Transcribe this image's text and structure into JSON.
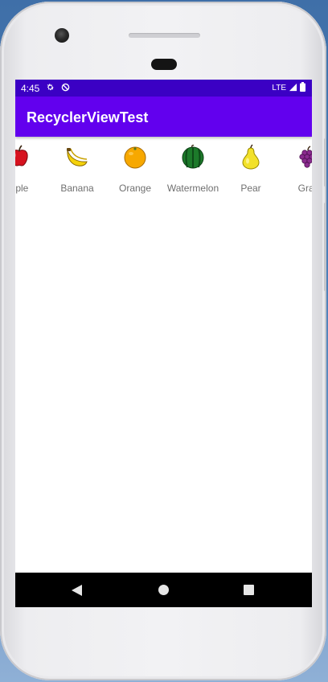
{
  "status_bar": {
    "time": "4:45",
    "icons": [
      "settings-icon",
      "no-disturb-icon"
    ],
    "network": "LTE",
    "right_icons": [
      "signal-icon",
      "battery-icon"
    ],
    "color": "#3b00c4"
  },
  "app_bar": {
    "title": "RecyclerViewTest",
    "color": "#6200ee"
  },
  "fruit_list": {
    "orientation": "horizontal",
    "items": [
      {
        "name": "Apple",
        "visible_text": "pple",
        "icon": "apple-icon"
      },
      {
        "name": "Banana",
        "visible_text": "Banana",
        "icon": "banana-icon"
      },
      {
        "name": "Orange",
        "visible_text": "Orange",
        "icon": "orange-icon"
      },
      {
        "name": "Watermelon",
        "visible_text": "Watermelon",
        "icon": "watermelon-icon"
      },
      {
        "name": "Pear",
        "visible_text": "Pear",
        "icon": "pear-icon"
      },
      {
        "name": "Grape",
        "visible_text": "Grap",
        "icon": "grape-icon"
      }
    ]
  },
  "nav_bar": {
    "buttons": [
      "back-icon",
      "home-icon",
      "recents-icon"
    ]
  }
}
